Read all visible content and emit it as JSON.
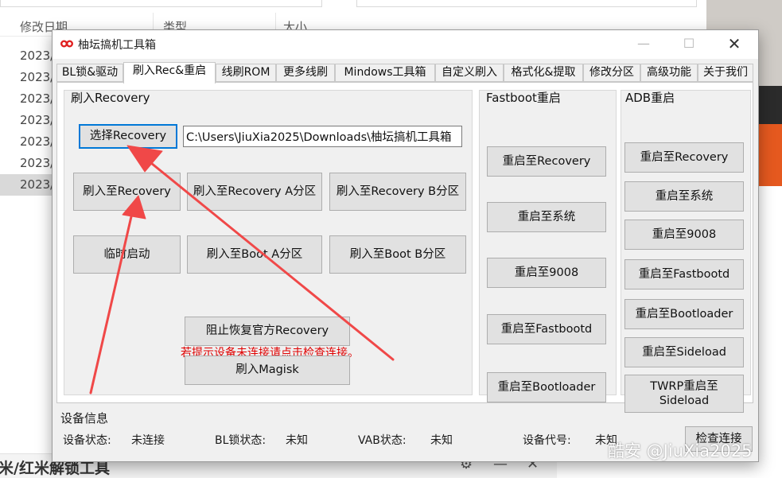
{
  "background": {
    "columns": [
      "修改日期",
      "类型",
      "大小"
    ],
    "rows": [
      "2023/",
      "2023/",
      "2023/",
      "2023/",
      "2023/",
      "2023/",
      "2023/"
    ],
    "bottom_title": "米/红米解锁工具"
  },
  "window": {
    "title": "柚坛搞机工具箱",
    "close_glyph": "✕",
    "minimize_glyph": "—",
    "maximize_glyph": "☐"
  },
  "tabs": [
    "BL锁&驱动",
    "刷入Rec&重启",
    "线刷ROM",
    "更多线刷",
    "Mindows工具箱",
    "自定义刷入",
    "格式化&提取",
    "修改分区",
    "高级功能",
    "关于我们"
  ],
  "flash_recovery": {
    "title": "刷入Recovery",
    "select_button": "选择Recovery",
    "path_value": "C:\\Users\\JiuXia2025\\Downloads\\柚坛搞机工具箱",
    "flash_to_recovery": "刷入至Recovery",
    "flash_to_recovery_a": "刷入至Recovery A分区",
    "flash_to_recovery_b": "刷入至Recovery B分区",
    "temp_boot": "临时启动",
    "flash_to_boot_a": "刷入至Boot A分区",
    "flash_to_boot_b": "刷入至Boot B分区",
    "warning": "若提示设备未连接请点击检查连接。",
    "block_official_recovery": "阻止恢复官方Recovery",
    "flash_magisk": "刷入Magisk"
  },
  "fastboot_reboot": {
    "title": "Fastboot重启",
    "buttons": [
      "重启至Recovery",
      "重启至系统",
      "重启至9008",
      "重启至Fastbootd",
      "重启至Bootloader"
    ]
  },
  "adb_reboot": {
    "title": "ADB重启",
    "buttons": [
      "重启至Recovery",
      "重启至系统",
      "重启至9008",
      "重启至Fastbootd",
      "重启至Bootloader",
      "重启至Sideload",
      "TWRP重启至Sideload"
    ]
  },
  "device_info": {
    "title": "设备信息",
    "status_label": "设备状态:",
    "status_value": "未连接",
    "bl_label": "BL锁状态:",
    "bl_value": "未知",
    "vab_label": "VAB状态:",
    "vab_value": "未知",
    "code_label": "设备代号:",
    "code_value": "未知",
    "check_button": "检查连接"
  },
  "watermark": "酷安 @JiuXia2025",
  "colors": {
    "arrow": "#f04848",
    "warning": "#e00000",
    "focus_border": "#0078d7"
  }
}
